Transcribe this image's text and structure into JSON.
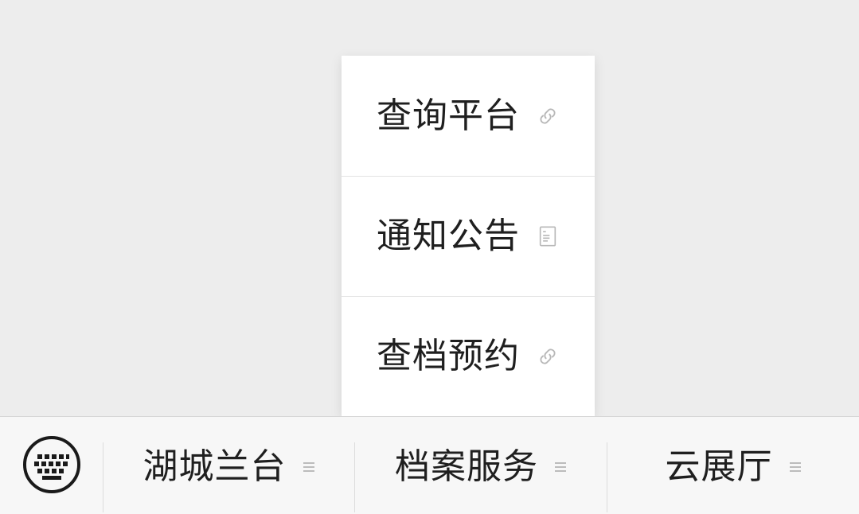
{
  "popup_menu": {
    "items": [
      {
        "label": "查询平台",
        "icon": "link-icon"
      },
      {
        "label": "通知公告",
        "icon": "document-icon"
      },
      {
        "label": "查档预约",
        "icon": "link-icon"
      }
    ]
  },
  "bottom_bar": {
    "keyboard_icon": "keyboard-icon",
    "tabs": [
      {
        "label": "湖城兰台",
        "icon": "menu-icon"
      },
      {
        "label": "档案服务",
        "icon": "menu-icon"
      },
      {
        "label": "云展厅",
        "icon": "menu-icon"
      }
    ]
  },
  "colors": {
    "background": "#ededed",
    "popup_bg": "#ffffff",
    "bar_bg": "#f7f7f7",
    "text": "#1f1f1f",
    "icon_gray": "#b5b5b5"
  }
}
